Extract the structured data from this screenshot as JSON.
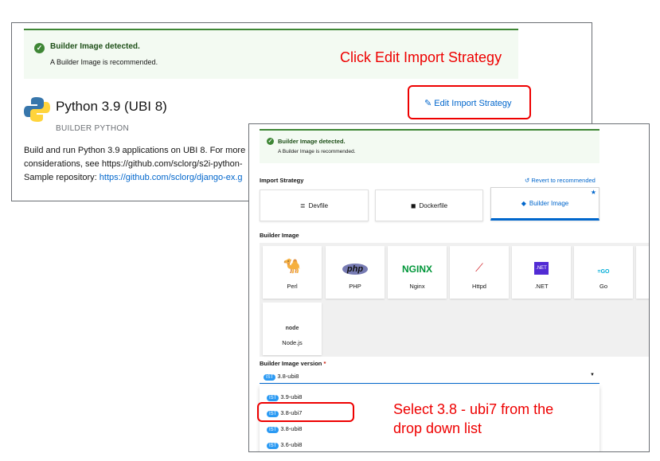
{
  "background_panel": {
    "alert": {
      "title": "Builder Image detected.",
      "body": "A Builder Image is recommended."
    },
    "builder": {
      "title": "Python 3.9 (UBI 8)",
      "subtitle": "BUILDER PYTHON",
      "desc1": "Build and run Python 3.9 applications on UBI 8. For more i",
      "desc2": "considerations, see https://github.com/sclorg/s2i-python-",
      "sample_label": "Sample repository: ",
      "sample_link": "https://github.com/sclorg/django-ex.g"
    },
    "edit_button": "Edit Import Strategy"
  },
  "annotations": {
    "step1": "Click Edit Import Strategy",
    "step2_l1": "Select 3.8 - ubi7 from the",
    "step2_l2": "drop down list"
  },
  "form": {
    "alert": {
      "title": "Builder Image detected.",
      "body": "A Builder Image is recommended."
    },
    "import_strategy_label": "Import Strategy",
    "revert": "Revert to recommended",
    "strategies": [
      {
        "label": "Devfile"
      },
      {
        "label": "Dockerfile"
      },
      {
        "label": "Builder Image",
        "selected": true
      }
    ],
    "builder_image_label": "Builder Image",
    "images": [
      {
        "label": "Perl"
      },
      {
        "label": "PHP"
      },
      {
        "label": "Nginx"
      },
      {
        "label": "Httpd"
      },
      {
        "label": ".NET"
      },
      {
        "label": "Go"
      },
      {
        "label": "Node.js"
      }
    ],
    "version_label": "Builder Image version",
    "required": "*",
    "badge": "IST",
    "version_value": "3.8-ubi8",
    "options": [
      "3.9-ubi8",
      "3.8-ubi7",
      "3.8-ubi8",
      "3.6-ubi8"
    ]
  },
  "colors": {
    "accent": "#0066cc",
    "success": "#3e8635",
    "annotation": "#ee0000"
  }
}
